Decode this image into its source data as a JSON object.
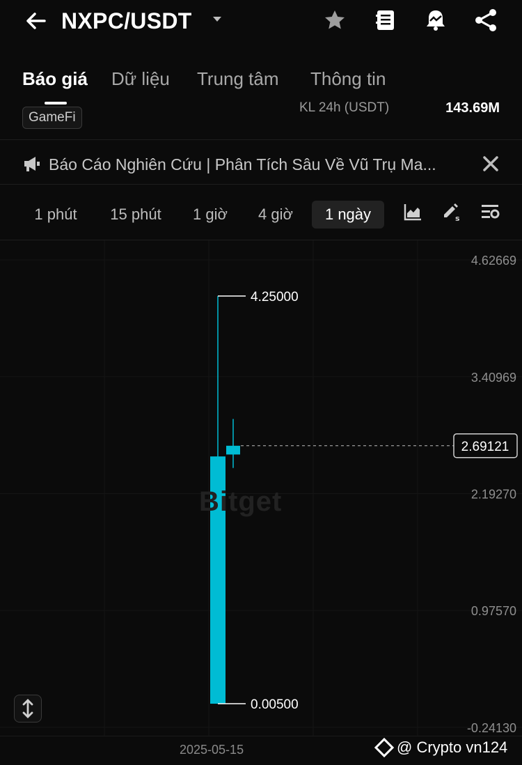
{
  "header": {
    "pair": "NXPC/USDT",
    "icons": [
      "back-arrow-icon",
      "dropdown-caret-icon",
      "star-icon",
      "notes-icon",
      "price-alert-icon",
      "share-icon"
    ]
  },
  "tabs": [
    {
      "label": "Báo giá",
      "active": true
    },
    {
      "label": "Dữ liệu",
      "active": false
    },
    {
      "label": "Trung tâm",
      "active": false
    },
    {
      "label": "Thông tin",
      "active": false
    }
  ],
  "stats": {
    "tag": "GameFi",
    "volume_label": "KL 24h (USDT)",
    "volume_value": "143.69M"
  },
  "announcement": {
    "text": "Báo Cáo Nghiên Cứu | Phân Tích Sâu Về Vũ Trụ Ma..."
  },
  "timeframes": [
    {
      "label": "1 phút",
      "active": false
    },
    {
      "label": "15 phút",
      "active": false
    },
    {
      "label": "1 giờ",
      "active": false
    },
    {
      "label": "4 giờ",
      "active": false
    },
    {
      "label": "1 ngày",
      "active": true
    }
  ],
  "tools": [
    "indicator-chart-icon",
    "drawing-tool-icon",
    "chart-settings-icon"
  ],
  "chart_data": {
    "type": "candlestick",
    "y_ticks": [
      "4.62669",
      "3.40969",
      "2.19270",
      "0.97570",
      "-0.24130"
    ],
    "y_tick_values": [
      4.62669,
      3.40969,
      2.1927,
      0.9757,
      -0.2413
    ],
    "ylim": [
      -0.2413,
      4.62669
    ],
    "x_tick": "2025-05-15",
    "candles": [
      {
        "date": "2025-05-15",
        "open": 0.005,
        "high": 4.25,
        "low": 0.005,
        "close": 2.58
      },
      {
        "date": "2025-05-16",
        "open": 2.6,
        "high": 2.97,
        "low": 2.46,
        "close": 2.69121
      }
    ],
    "high_label": "4.25000",
    "low_label": "0.00500",
    "current_price_label": "2.69121",
    "current_price": 2.69121,
    "color": "#00bcd4",
    "grid": true
  },
  "watermark": "Bitget",
  "credit": "@ Crypto vn124"
}
